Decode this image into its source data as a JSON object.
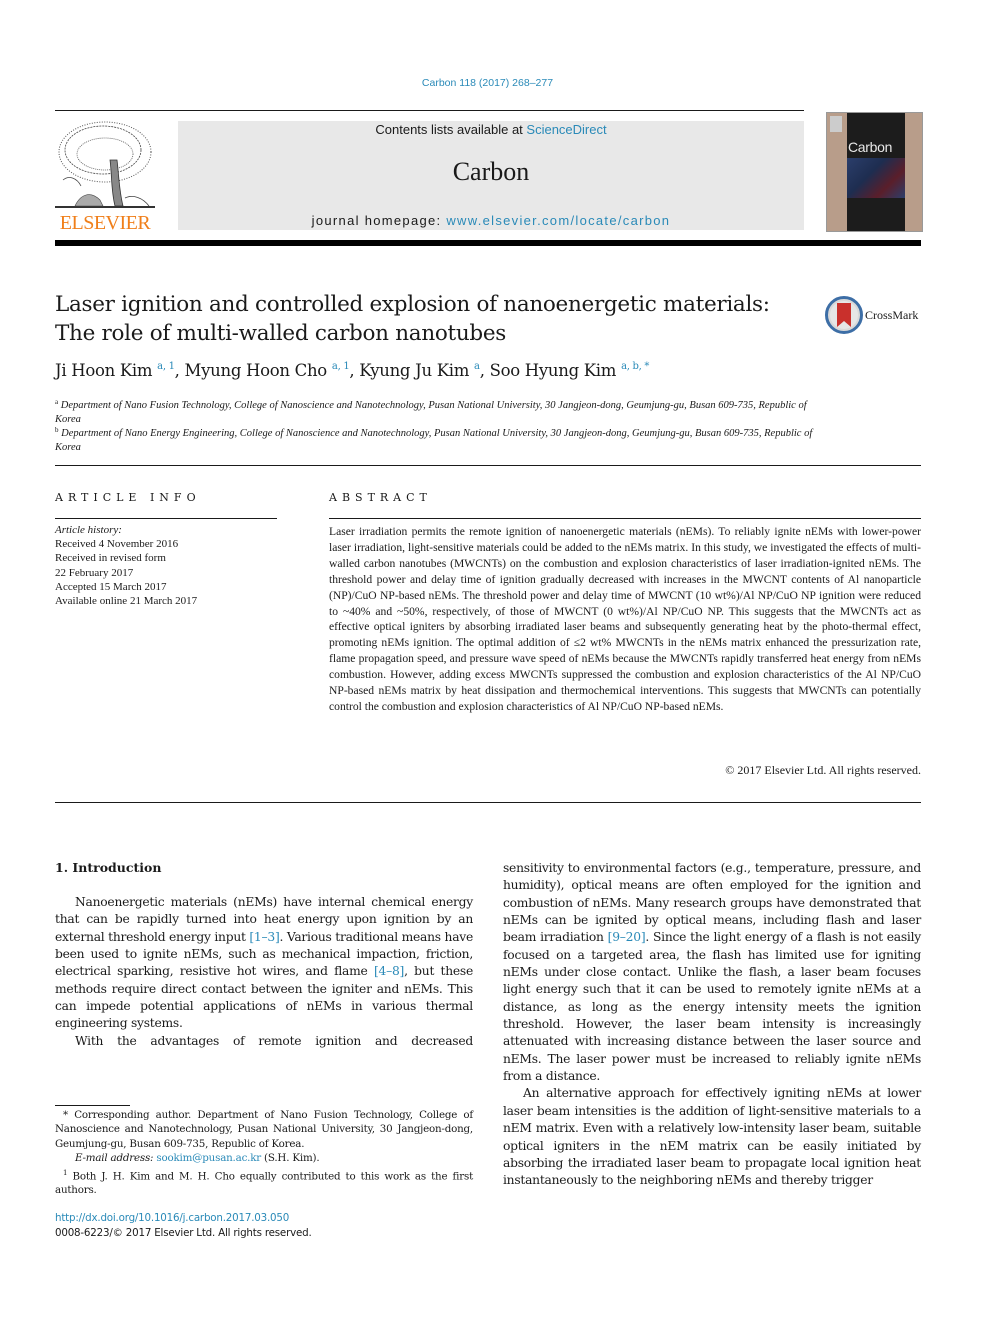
{
  "header": {
    "citation": "Carbon 118 (2017) 268–277",
    "contents_prefix": "Contents lists available at ",
    "contents_link": "ScienceDirect",
    "journal_name": "Carbon",
    "homepage_prefix": "journal homepage: ",
    "homepage_link": "www.elsevier.com/locate/carbon",
    "publisher_logo_text": "ELSEVIER",
    "cover_title": "Carbon",
    "brand_color": "#f07f1a",
    "link_color": "#2a8ab8"
  },
  "article": {
    "title_line1": "Laser ignition and controlled explosion of nanoenergetic materials:",
    "title_line2": "The role of multi-walled carbon nanotubes",
    "crossmark_label": "CrossMark",
    "authors": [
      {
        "name": "Ji Hoon Kim",
        "sup": "a, 1",
        "sep": ", "
      },
      {
        "name": "Myung Hoon Cho",
        "sup": "a, 1",
        "sep": ", "
      },
      {
        "name": "Kyung Ju Kim",
        "sup": "a",
        "sep": ", "
      },
      {
        "name": "Soo Hyung Kim",
        "sup": "a, b, *",
        "sep": ""
      }
    ],
    "affiliations": [
      {
        "mark": "a",
        "text": "Department of Nano Fusion Technology, College of Nanoscience and Nanotechnology, Pusan National University, 30 Jangjeon-dong, Geumjung-gu, Busan 609-735, Republic of Korea"
      },
      {
        "mark": "b",
        "text": "Department of Nano Energy Engineering, College of Nanoscience and Nanotechnology, Pusan National University, 30 Jangjeon-dong, Geumjung-gu, Busan 609-735, Republic of Korea"
      }
    ]
  },
  "article_info": {
    "heading": "ARTICLE INFO",
    "history_label": "Article history:",
    "history": [
      "Received 4 November 2016",
      "Received in revised form",
      "22 February 2017",
      "Accepted 15 March 2017",
      "Available online 21 March 2017"
    ]
  },
  "abstract": {
    "heading": "ABSTRACT",
    "text": "Laser irradiation permits the remote ignition of nanoenergetic materials (nEMs). To reliably ignite nEMs with lower-power laser irradiation, light-sensitive materials could be added to the nEMs matrix. In this study, we investigated the effects of multi-walled carbon nanotubes (MWCNTs) on the combustion and explosion characteristics of laser irradiation-ignited nEMs. The threshold power and delay time of ignition gradually decreased with increases in the MWCNT contents of Al nanoparticle (NP)/CuO NP-based nEMs. The threshold power and delay time of MWCNT (10 wt%)/Al NP/CuO NP ignition were reduced to ~40% and ~50%, respectively, of those of MWCNT (0 wt%)/Al NP/CuO NP. This suggests that the MWCNTs act as effective optical igniters by absorbing irradiated laser beams and subsequently gener­ating heat by the photo-thermal effect, promoting nEMs ignition. The optimal addition of ≤2 wt% MWCNTs in the nEMs matrix enhanced the pressurization rate, flame propagation speed, and pressure wave speed of nEMs because the MWCNTs rapidly transferred heat energy from nEMs combustion. However, adding excess MWCNTs suppressed the combustion and explosion characteristics of the Al NP/​CuO NP-based nEMs matrix by heat dissipation and thermochemical interventions. This suggests that MWCNTs can potentially control the combustion and explosion characteristics of Al NP/CuO NP-based nEMs.",
    "copyright": "© 2017 Elsevier Ltd. All rights reserved."
  },
  "introduction": {
    "heading": "1.  Introduction",
    "left_p1_a": "Nanoenergetic materials (nEMs) have internal chemical energy that can be rapidly turned into heat energy upon ignition by an external threshold energy input ",
    "left_p1_ref1": "[1–3]",
    "left_p1_b": ". Various traditional means have been used to ignite nEMs, such as mechanical impaction, friction, electrical sparking, resistive hot wires, and flame ",
    "left_p1_ref2": "[4–8]",
    "left_p1_c": ", but these methods require direct contact between the igniter and nEMs. This can impede potential applications of nEMs in various thermal engineering systems.",
    "left_p2": "With the advantages of remote ignition and decreased",
    "right_p1_a": "sensitivity to environmental factors (e.g., temperature, pressure, and humidity), optical means are often employed for the ignition and combustion of nEMs. Many research groups have demon­strated that nEMs can be ignited by optical means, including flash and laser beam irradiation ",
    "right_p1_ref": "[9–20]",
    "right_p1_b": ". Since the light energy of a flash is not easily focused on a targeted area, the flash has limited use for igniting nEMs under close contact. Unlike the flash, a laser beam focuses light energy such that it can be used to remotely ignite nEMs at a distance, as long as the energy intensity meets the ignition threshold. However, the laser beam intensity is increas­ingly attenuated with increasing distance between the laser source and nEMs. The laser power must be increased to reliably ignite nEMs from a distance.",
    "right_p2": "An alternative approach for effectively igniting nEMs at lower laser beam intensities is the addition of light-sensitive materials to a nEM matrix. Even with a relatively low-intensity laser beam, suitable optical igniters in the nEM matrix can be easily initiated by absorbing the irradiated laser beam to propagate local ignition heat instantaneously to the neighboring nEMs and thereby trigger"
  },
  "footnotes": {
    "corresponding_mark": "*",
    "corresponding": "Corresponding author. Department of Nano Fusion Technology, College of Nanoscience and Nanotechnology, Pusan National University, 30 Jangjeon-dong, Geumjung-gu, Busan 609-735, Republic of Korea.",
    "email_label": "E-mail address:",
    "email": "sookim@pusan.ac.kr",
    "email_suffix": " (S.H. Kim).",
    "equal_mark": "1",
    "equal": "Both J. H. Kim and M. H. Cho equally contributed to this work as the first authors."
  },
  "doi": {
    "link": "http://dx.doi.org/10.1016/j.carbon.2017.03.050",
    "issn": "0008-6223/© 2017 Elsevier Ltd. All rights reserved."
  }
}
